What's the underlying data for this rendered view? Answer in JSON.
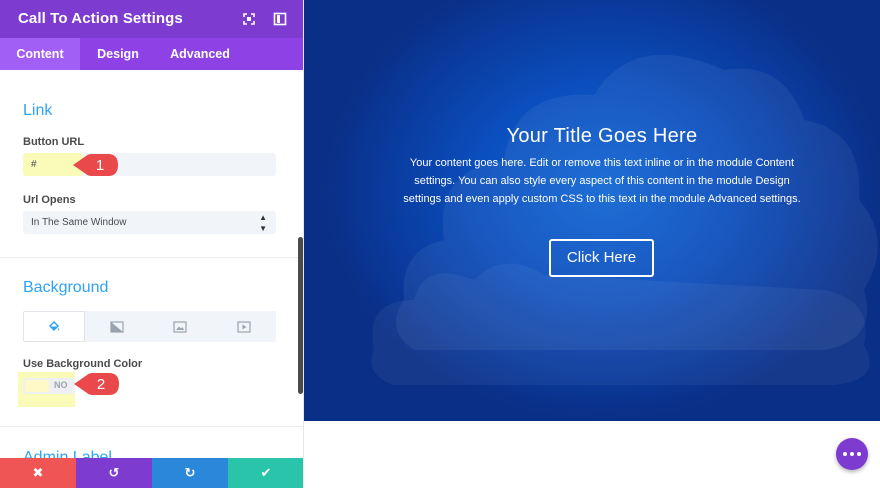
{
  "panel": {
    "title": "Call To Action Settings",
    "tabs": [
      {
        "label": "Content",
        "active": true
      },
      {
        "label": "Design",
        "active": false
      },
      {
        "label": "Advanced",
        "active": false
      }
    ]
  },
  "link_section": {
    "title": "Link",
    "button_url": {
      "label": "Button URL",
      "value": "#"
    },
    "url_opens": {
      "label": "Url Opens",
      "value": "In The Same Window"
    }
  },
  "background_section": {
    "title": "Background",
    "tabs": [
      "paint-bucket-icon",
      "gradient-icon",
      "image-icon",
      "video-icon"
    ],
    "use_color": {
      "label": "Use Background Color",
      "toggle_text": "NO"
    }
  },
  "admin_section": {
    "title": "Admin Label"
  },
  "callouts": [
    {
      "number": "1"
    },
    {
      "number": "2"
    }
  ],
  "actions": {
    "discard": "✖",
    "undo": "↺",
    "redo": "↻",
    "save": "✔"
  },
  "preview": {
    "title": "Your Title Goes Here",
    "body": "Your content goes here. Edit or remove this text inline or in the module Content settings. You can also style every aspect of this content in the module Design settings and even apply custom CSS to this text in the module Advanced settings.",
    "button_label": "Click Here"
  },
  "colors": {
    "header_purple": "#7e3bd0",
    "accent_blue": "#2ea3f2",
    "discard_red": "#ef5555",
    "redo_blue": "#2b87da",
    "save_green": "#29c4a9",
    "callout_red": "#e9494b"
  }
}
